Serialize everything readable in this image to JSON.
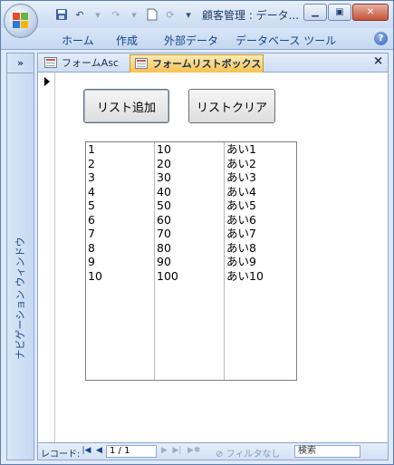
{
  "window": {
    "title": "顧客管理 : データ..."
  },
  "qat": {
    "save_icon": "save-icon",
    "undo_icon": "undo-icon",
    "redo_icon": "redo-icon"
  },
  "ribbon": {
    "tabs": [
      "ホーム",
      "作成",
      "外部データ",
      "データベース ツール"
    ]
  },
  "nav_pane": {
    "toggle": "»",
    "label": "ナビゲーション ウィンドウ"
  },
  "doc_tabs": [
    {
      "label": "フォームAsc"
    },
    {
      "label": "フォームリストボックス"
    }
  ],
  "doc_close": "×",
  "form": {
    "add_button": "リスト追加",
    "clear_button": "リストクリア",
    "list": {
      "rows": [
        [
          "1",
          "10",
          "あい1"
        ],
        [
          "2",
          "20",
          "あい2"
        ],
        [
          "3",
          "30",
          "あい3"
        ],
        [
          "4",
          "40",
          "あい4"
        ],
        [
          "5",
          "50",
          "あい5"
        ],
        [
          "6",
          "60",
          "あい6"
        ],
        [
          "7",
          "70",
          "あい7"
        ],
        [
          "8",
          "80",
          "あい8"
        ],
        [
          "9",
          "90",
          "あい9"
        ],
        [
          "10",
          "100",
          "あい10"
        ]
      ]
    }
  },
  "record_nav": {
    "label": "レコード:",
    "position": "1 / 1",
    "filter": "フィルタなし",
    "search_placeholder": "検索"
  }
}
